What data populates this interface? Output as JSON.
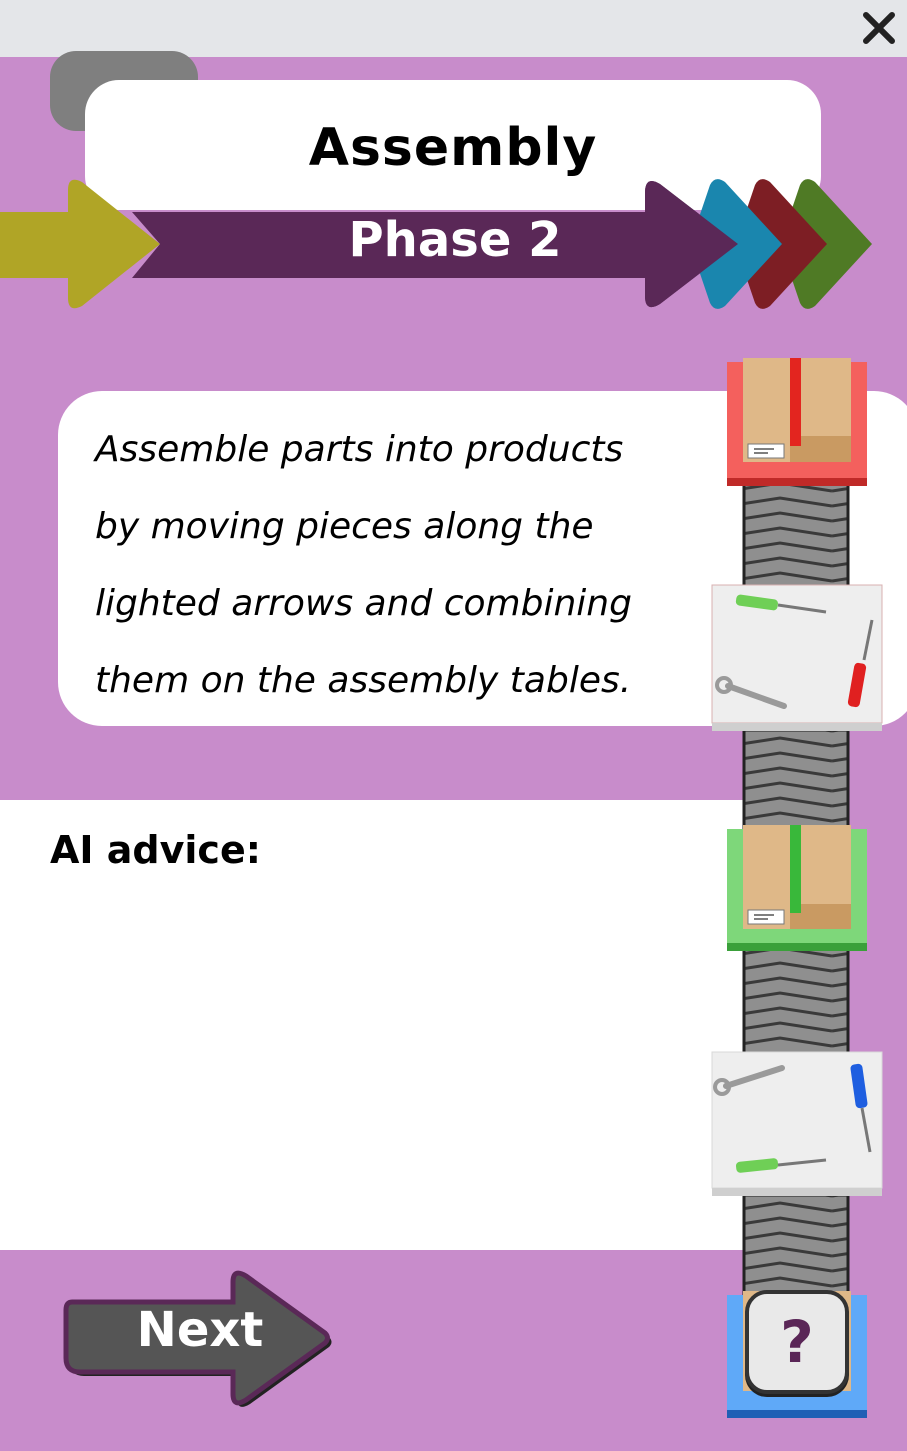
{
  "window": {
    "close_icon": "close-icon"
  },
  "header": {
    "title": "Assembly",
    "phase": "Phase 2"
  },
  "description": {
    "lines": [
      "Assemble parts into products",
      "by moving pieces along the",
      "lighted arrows and combining",
      "them on the assembly tables."
    ]
  },
  "advice": {
    "label": "AI advice:",
    "text": ""
  },
  "next_button": {
    "label": "Next"
  },
  "help_button": {
    "label": "?"
  },
  "colors": {
    "background": "#c88ccb",
    "phase_bar": "#5a2857",
    "chevron_olive": "#b0a526",
    "chevron_teal": "#1a86ae",
    "chevron_red": "#7d1e24",
    "chevron_green": "#4f7a25",
    "station_red": "#f4605d",
    "station_green": "#7ed77a",
    "station_blue": "#5fa9f8"
  }
}
